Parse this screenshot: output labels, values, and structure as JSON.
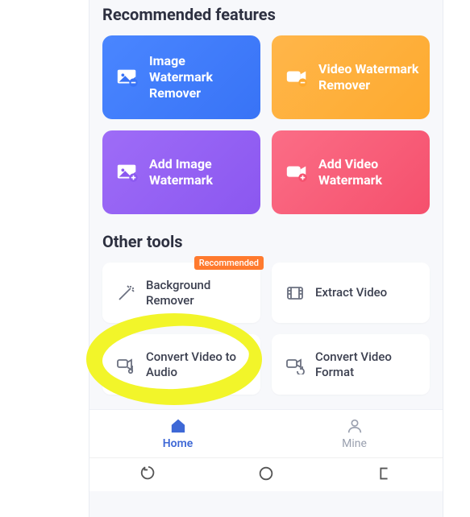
{
  "sections": {
    "recommended_title": "Recommended features",
    "other_title": "Other tools"
  },
  "featured": [
    {
      "label": "Image Watermark Remover",
      "icon": "image-minus-icon"
    },
    {
      "label": "Video Watermark Remover",
      "icon": "video-minus-icon"
    },
    {
      "label": "Add Image Watermark",
      "icon": "image-plus-icon"
    },
    {
      "label": "Add Video Watermark",
      "icon": "video-plus-icon"
    }
  ],
  "other": [
    {
      "label": "Background Remover",
      "icon": "wand-icon",
      "badge": "Recommended"
    },
    {
      "label": "Extract Video",
      "icon": "film-icon"
    },
    {
      "label": "Convert Video to Audio",
      "icon": "video-audio-icon"
    },
    {
      "label": "Convert Video Format",
      "icon": "video-convert-icon"
    }
  ],
  "tabs": {
    "home": "Home",
    "mine": "Mine"
  },
  "annotation": {
    "highlight_color": "#f2f52a"
  }
}
